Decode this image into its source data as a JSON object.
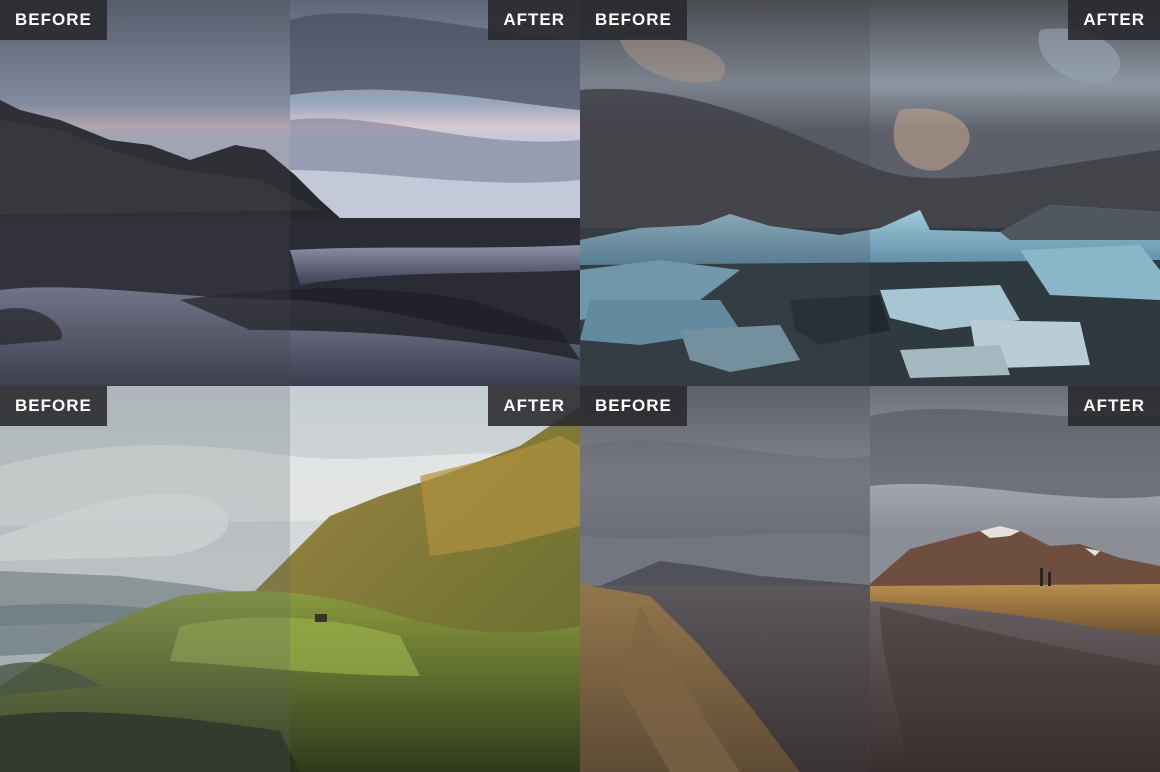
{
  "labels": {
    "before": "BEFORE",
    "after": "AFTER"
  },
  "panels": [
    {
      "scene": "black sand beach with jagged mountain and cloudy sky"
    },
    {
      "scene": "glacier lagoon with blue icebergs under dramatic clouds"
    },
    {
      "scene": "green mossy hillside with small hut and misty valley"
    },
    {
      "scene": "golden grass riverbank with snow-capped mountain under storm clouds"
    }
  ]
}
